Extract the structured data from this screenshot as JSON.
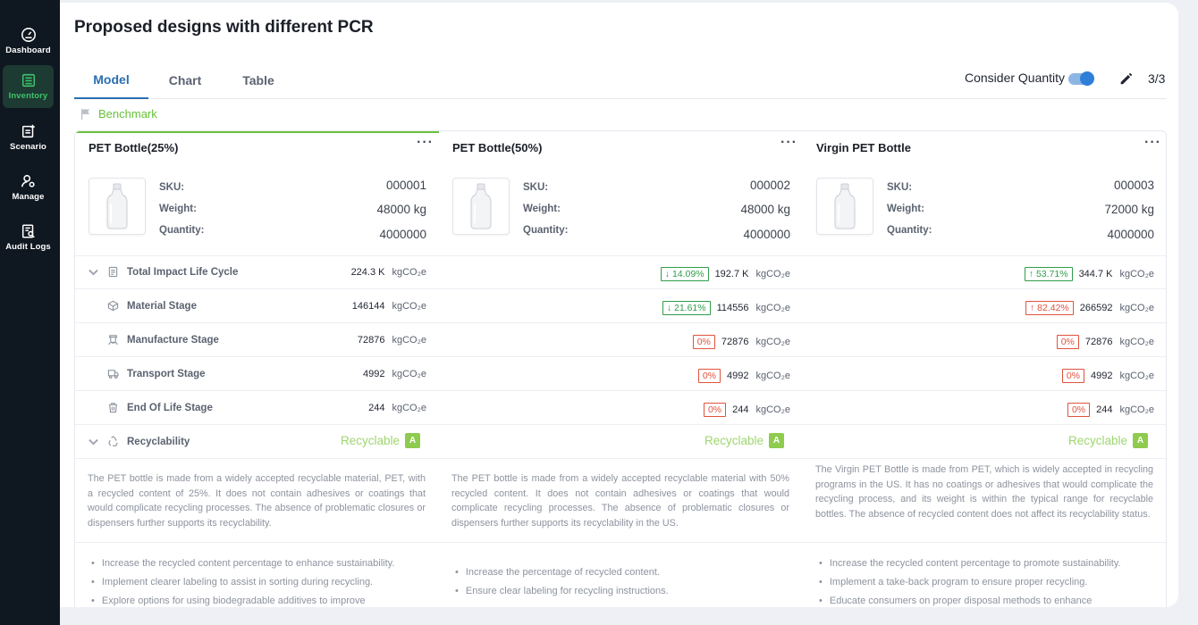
{
  "nav": [
    {
      "label": "Dashboard",
      "icon": "gauge-icon"
    },
    {
      "label": "Inventory",
      "icon": "inventory-icon"
    },
    {
      "label": "Scenario",
      "icon": "scenario-icon"
    },
    {
      "label": "Manage",
      "icon": "manage-icon"
    },
    {
      "label": "Audit Logs",
      "icon": "audit-icon"
    }
  ],
  "page": {
    "title": "Proposed designs with different PCR",
    "tabs": [
      "Model",
      "Chart",
      "Table"
    ],
    "consider_label": "Consider Quantity",
    "consider_on": true,
    "pager": "3/3",
    "benchmark_label": "Benchmark"
  },
  "labels": {
    "sku": "SKU:",
    "weight": "Weight:",
    "quantity": "Quantity:",
    "total": "Total Impact Life Cycle",
    "material": "Material Stage",
    "manufacture": "Manufacture Stage",
    "transport": "Transport Stage",
    "eol": "End Of Life Stage",
    "recyclability": "Recyclability",
    "unit": "kgCO₂e"
  },
  "products": [
    {
      "name": "PET Bottle(25%)",
      "more": "···",
      "sku": "000001",
      "weight": "48000 kg",
      "quantity": "4000000",
      "total": {
        "change": "",
        "dir": "",
        "value": "224.3 K"
      },
      "material": {
        "change": "",
        "dir": "",
        "value": "146144"
      },
      "manufacture": {
        "change": "",
        "dir": "",
        "value": "72876"
      },
      "transport": {
        "change": "",
        "dir": "",
        "value": "4992"
      },
      "eol": {
        "change": "",
        "dir": "",
        "value": "244"
      },
      "recyclable": "Recyclable",
      "grade": "A",
      "description": "The PET bottle is made from a widely accepted recyclable material, PET, with a recycled content of 25%. It does not contain adhesives or coatings that would complicate recycling processes. The absence of problematic closures or dispensers further supports its recyclability.",
      "suggestions": [
        "Increase the recycled content percentage to enhance sustainability.",
        "Implement clearer labeling to assist in sorting during recycling.",
        "Explore options for using biodegradable additives to improve"
      ]
    },
    {
      "name": "PET Bottle(50%)",
      "more": "···",
      "sku": "000002",
      "weight": "48000 kg",
      "quantity": "4000000",
      "total": {
        "change": "↓ 14.09%",
        "dir": "down",
        "value": "192.7 K"
      },
      "material": {
        "change": "↓ 21.61%",
        "dir": "down",
        "value": "114556"
      },
      "manufacture": {
        "change": "0%",
        "dir": "up",
        "value": "72876"
      },
      "transport": {
        "change": "0%",
        "dir": "up",
        "value": "4992"
      },
      "eol": {
        "change": "0%",
        "dir": "up",
        "value": "244"
      },
      "recyclable": "Recyclable",
      "grade": "A",
      "description": "The PET bottle is made from a widely accepted recyclable material with 50% recycled content. It does not contain adhesives or coatings that would complicate recycling processes. The absence of problematic closures or dispensers further supports its recyclability in the US.",
      "suggestions": [
        "Increase the percentage of recycled content.",
        "Ensure clear labeling for recycling instructions."
      ]
    },
    {
      "name": "Virgin PET Bottle",
      "more": "···",
      "sku": "000003",
      "weight": "72000 kg",
      "quantity": "4000000",
      "total": {
        "change": "↑ 53.71%",
        "dir": "down",
        "value": "344.7 K"
      },
      "material": {
        "change": "↑ 82.42%",
        "dir": "up",
        "value": "266592"
      },
      "manufacture": {
        "change": "0%",
        "dir": "up",
        "value": "72876"
      },
      "transport": {
        "change": "0%",
        "dir": "up",
        "value": "4992"
      },
      "eol": {
        "change": "0%",
        "dir": "up",
        "value": "244"
      },
      "recyclable": "Recyclable",
      "grade": "A",
      "description": "The Virgin PET Bottle is made from PET, which is widely accepted in recycling programs in the US. It has no coatings or adhesives that would complicate the recycling process, and its weight is within the typical range for recyclable bottles. The absence of recycled content does not affect its recyclability status.",
      "suggestions": [
        "Increase the recycled content percentage to promote sustainability.",
        "Implement a take-back program to ensure proper recycling.",
        "Educate consumers on proper disposal methods to enhance"
      ]
    }
  ]
}
